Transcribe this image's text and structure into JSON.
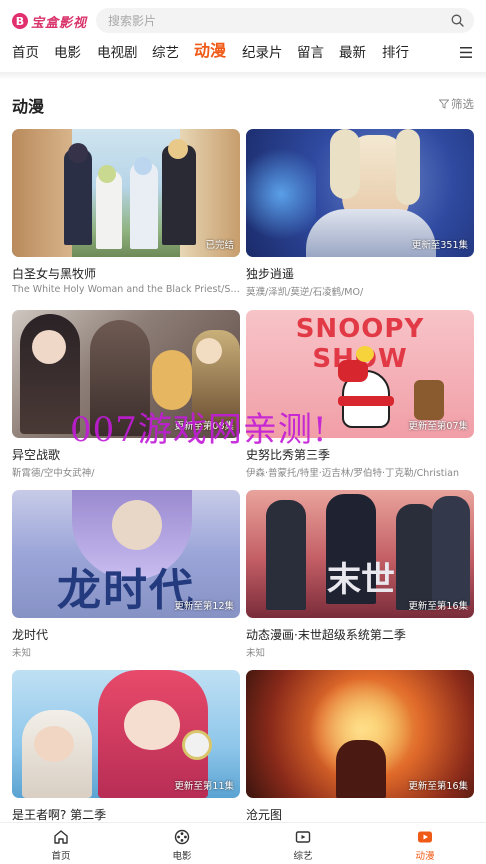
{
  "app": {
    "logo_text": "宝盒影视",
    "logo_mark": "B"
  },
  "search": {
    "placeholder": "搜索影片"
  },
  "nav": {
    "items": [
      {
        "label": "首页"
      },
      {
        "label": "电影"
      },
      {
        "label": "电视剧"
      },
      {
        "label": "综艺"
      },
      {
        "label": "动漫",
        "active": true
      },
      {
        "label": "纪录片"
      },
      {
        "label": "留言"
      },
      {
        "label": "最新"
      },
      {
        "label": "排行"
      }
    ],
    "menu_icon": "hamburger-icon"
  },
  "section": {
    "title": "动漫",
    "filter_label": "筛选"
  },
  "cards": [
    {
      "title": "白圣女与黑牧师",
      "subtitle": "The White Holy Woman and the Black Priest/Shiro Seijo to Kuro Bokushi",
      "badge": "已完结"
    },
    {
      "title": "独步逍遥",
      "subtitle": "莫濮/泽凯/莫逆/石凌鹤/MO/",
      "badge": "更新至351集"
    },
    {
      "title": "异空战歌",
      "subtitle": "靳霄德/空中女武神/",
      "badge": "更新至第08集"
    },
    {
      "title": "史努比秀第三季",
      "subtitle": "伊森·普蒙托/特里·迈吉林/罗伯特·丁克勒/Christian",
      "badge": "更新至第07集",
      "art_text": "SNOOPY SHOW"
    },
    {
      "title": "龙时代",
      "subtitle": "未知",
      "badge": "更新至第12集",
      "art_text": "龙时代"
    },
    {
      "title": "动态漫画·末世超级系统第二季",
      "subtitle": "未知",
      "badge": "更新至第16集",
      "art_text": "末世"
    },
    {
      "title": "是王者啊? 第二季",
      "subtitle": "",
      "badge": "更新至第11集"
    },
    {
      "title": "沧元图",
      "subtitle": "",
      "badge": "更新至第16集"
    }
  ],
  "watermark": "007游戏网亲测!",
  "tabbar": {
    "items": [
      {
        "label": "首页",
        "icon": "home-icon"
      },
      {
        "label": "电影",
        "icon": "film-reel-icon"
      },
      {
        "label": "综艺",
        "icon": "video-screen-icon"
      },
      {
        "label": "动漫",
        "icon": "play-icon",
        "active": true
      }
    ]
  },
  "colors": {
    "accent": "#f05a17",
    "logo": "#d8336a",
    "watermark": "#c21bd8"
  }
}
